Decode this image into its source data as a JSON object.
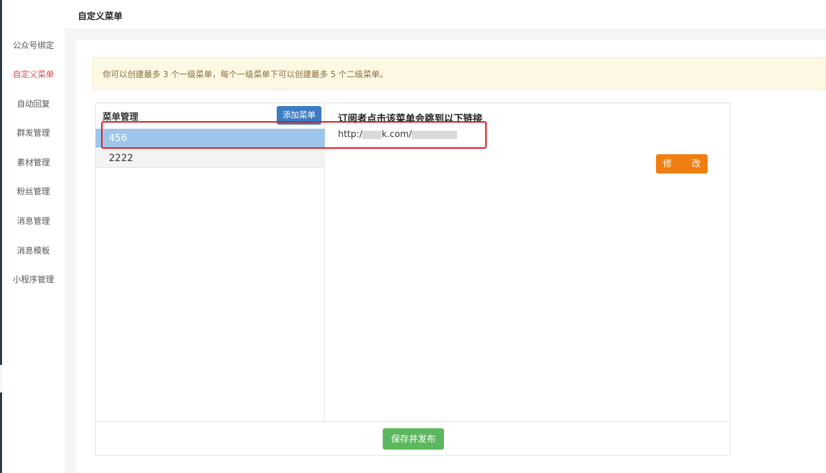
{
  "sidebar": {
    "items": [
      {
        "label": "公众号绑定"
      },
      {
        "label": "自定义菜单"
      },
      {
        "label": "自动回复"
      },
      {
        "label": "群发管理"
      },
      {
        "label": "素材管理"
      },
      {
        "label": "粉丝管理"
      },
      {
        "label": "消息管理"
      },
      {
        "label": "消息模板"
      },
      {
        "label": "小程序管理"
      }
    ],
    "active_index": 1
  },
  "header": {
    "title": "自定义菜单"
  },
  "notice": {
    "text": "你可以创建最多 3 个一级菜单，每个一级菜单下可以创建最多 5 个二级菜单。"
  },
  "menu_panel": {
    "title": "菜单管理",
    "add_label": "添加菜单",
    "items": [
      {
        "label": "456",
        "selected": true
      },
      {
        "label": "2222",
        "selected": false
      }
    ]
  },
  "detail": {
    "title": "订阅者点击该菜单会跳到以下链接",
    "url_prefix": "http:/",
    "url_mid": "k.com/",
    "edit_label": "修　改"
  },
  "footer": {
    "save_label": "保存并发布"
  },
  "colors": {
    "active_sidebar": "#e8474d",
    "add_button": "#3c7cc2",
    "edit_button": "#f07e10",
    "save_button": "#5cb85c",
    "selected_row": "#9ec6ea",
    "annotation_box": "#e0191c"
  }
}
